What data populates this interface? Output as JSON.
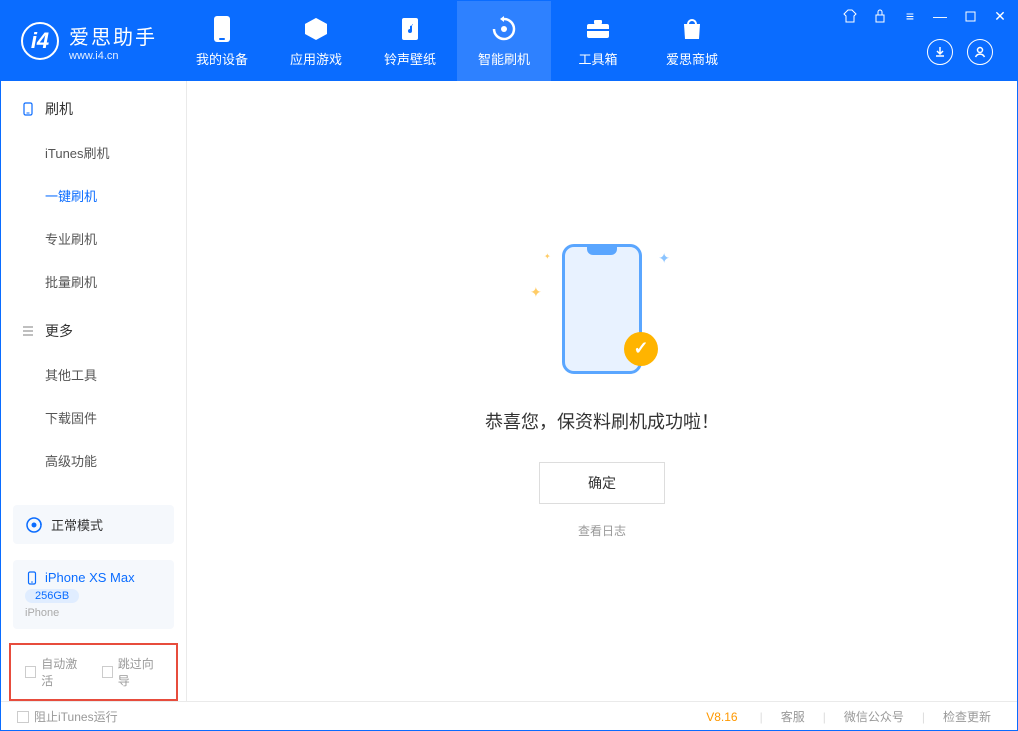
{
  "app": {
    "title": "爱思助手",
    "subtitle": "www.i4.cn"
  },
  "nav": {
    "device": "我的设备",
    "apps": "应用游戏",
    "ring": "铃声壁纸",
    "flash": "智能刷机",
    "toolbox": "工具箱",
    "store": "爱思商城"
  },
  "sidebar": {
    "section1": "刷机",
    "itunes": "iTunes刷机",
    "oneclick": "一键刷机",
    "pro": "专业刷机",
    "batch": "批量刷机",
    "section2": "更多",
    "other": "其他工具",
    "firmware": "下载固件",
    "advanced": "高级功能"
  },
  "mode": {
    "label": "正常模式"
  },
  "device": {
    "name": "iPhone XS Max",
    "capacity": "256GB",
    "type": "iPhone"
  },
  "options": {
    "auto_activate": "自动激活",
    "skip_guide": "跳过向导"
  },
  "result": {
    "title": "恭喜您，保资料刷机成功啦！",
    "confirm": "确定",
    "log": "查看日志"
  },
  "footer": {
    "block_itunes": "阻止iTunes运行",
    "version": "V8.16",
    "service": "客服",
    "wechat": "微信公众号",
    "update": "检查更新"
  }
}
